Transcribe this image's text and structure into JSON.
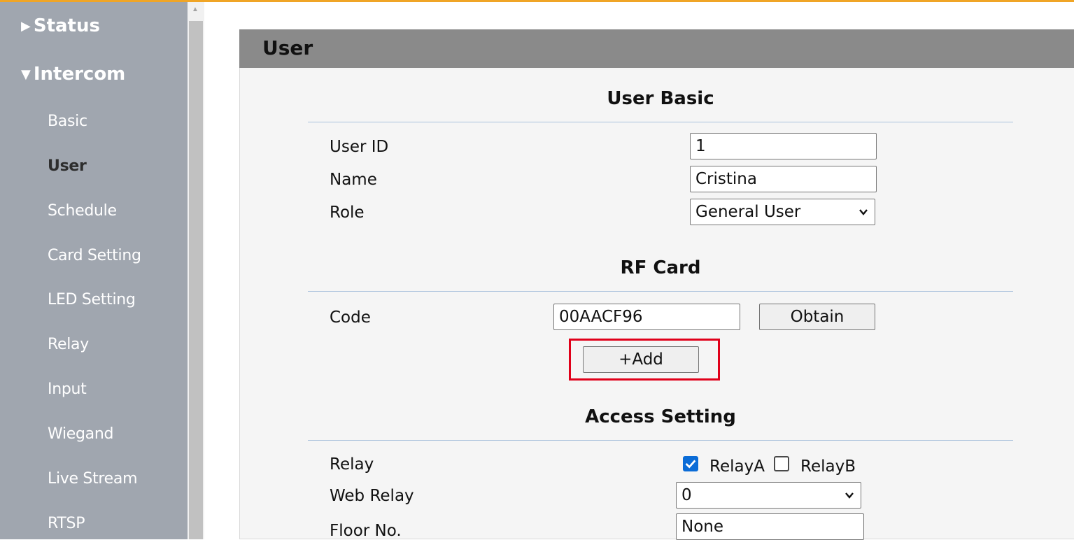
{
  "sidebar": {
    "sections": [
      {
        "label": "Status",
        "state": "collapsed"
      },
      {
        "label": "Intercom",
        "state": "expanded"
      }
    ],
    "items": [
      {
        "label": "Basic"
      },
      {
        "label": "User"
      },
      {
        "label": "Schedule"
      },
      {
        "label": "Card Setting"
      },
      {
        "label": "LED Setting"
      },
      {
        "label": "Relay"
      },
      {
        "label": "Input"
      },
      {
        "label": "Wiegand"
      },
      {
        "label": "Live Stream"
      },
      {
        "label": "RTSP"
      }
    ],
    "active_item": "User"
  },
  "page": {
    "title": "User"
  },
  "user_basic": {
    "title": "User Basic",
    "user_id": {
      "label": "User ID",
      "value": "1"
    },
    "name": {
      "label": "Name",
      "value": "Cristina"
    },
    "role": {
      "label": "Role",
      "value": "General User"
    }
  },
  "rf_card": {
    "title": "RF Card",
    "code": {
      "label": "Code",
      "value": "00AACF96"
    },
    "obtain_label": "Obtain",
    "add_label": "+Add"
  },
  "access_setting": {
    "title": "Access Setting",
    "relay": {
      "label": "Relay",
      "options": [
        {
          "label": "RelayA",
          "checked": true
        },
        {
          "label": "RelayB",
          "checked": false
        }
      ]
    },
    "web_relay": {
      "label": "Web Relay",
      "value": "0"
    },
    "floor_no": {
      "label": "Floor No.",
      "value": "None"
    }
  },
  "colors": {
    "accent_bar": "#f0a526",
    "sidebar_bg": "#a0a6af",
    "header_bg": "#8a8a8a",
    "highlight": "#e0001a",
    "checkbox_on": "#0b6cd7"
  }
}
